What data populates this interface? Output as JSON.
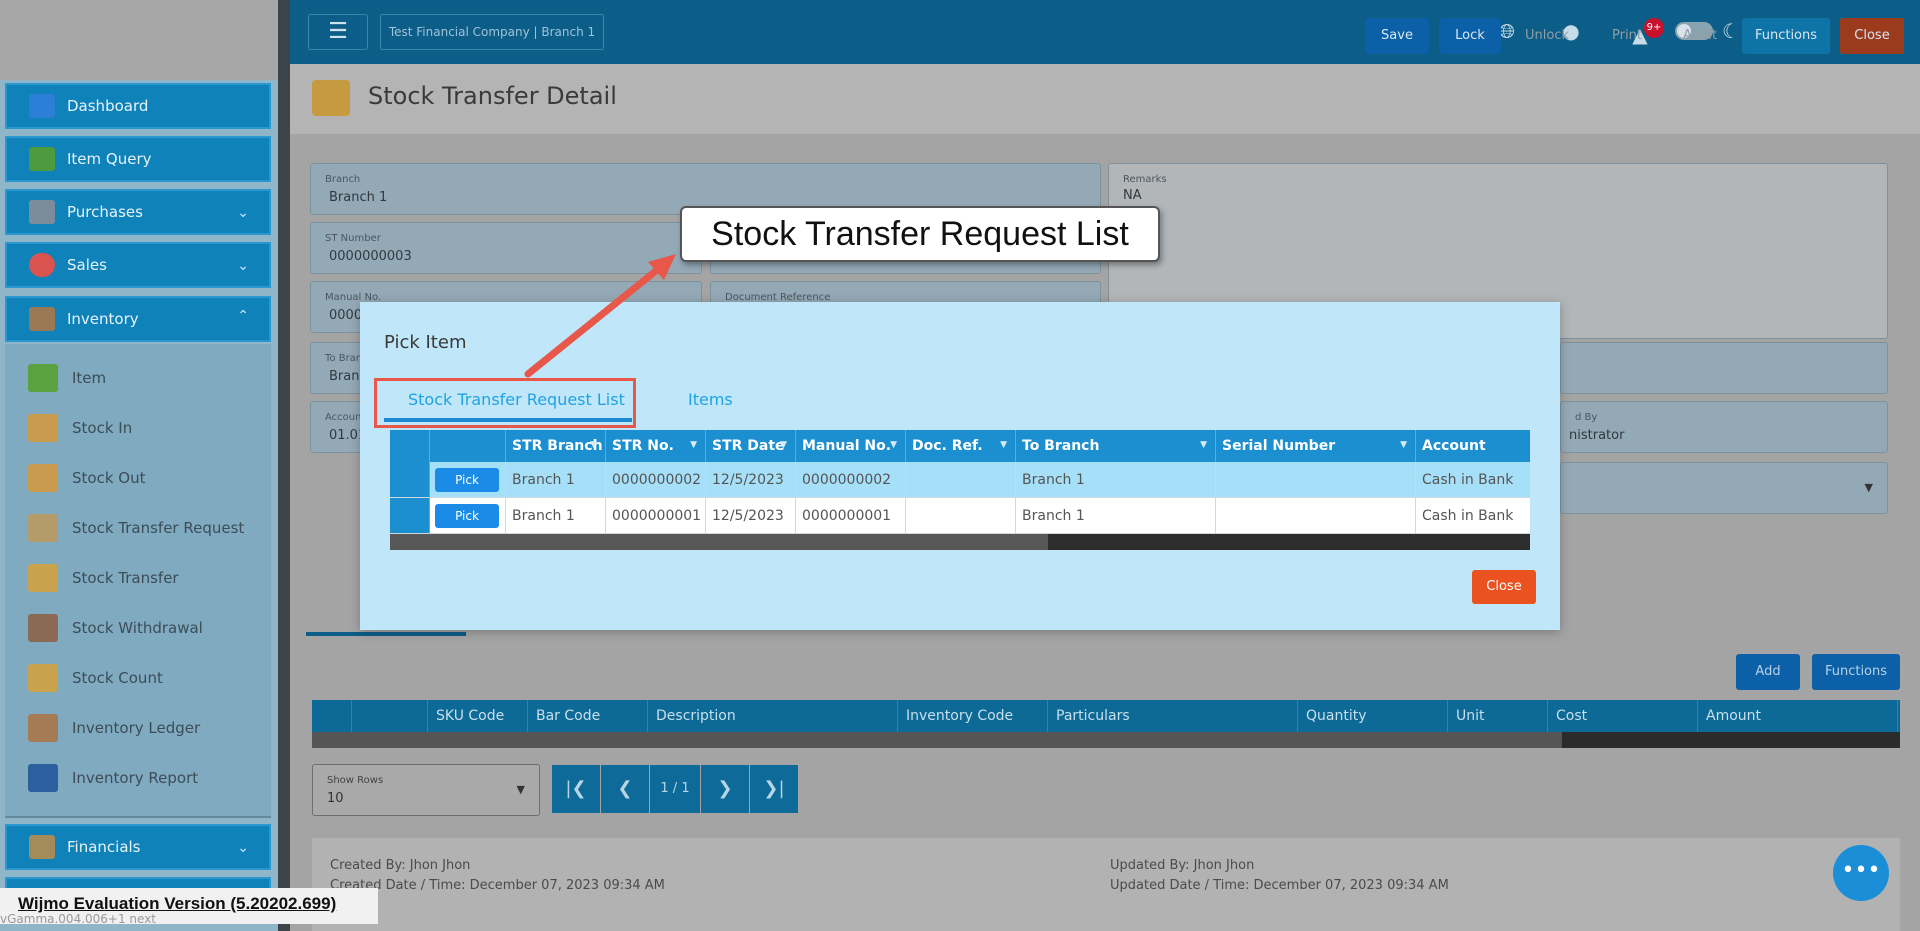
{
  "sidebar": {
    "items": [
      {
        "label": "Dashboard",
        "icon": "dashboard-icon",
        "color": "#2b7fd6"
      },
      {
        "label": "Item Query",
        "icon": "basket-icon",
        "color": "#4e9a3e"
      },
      {
        "label": "Purchases",
        "icon": "purchases-icon",
        "color": "#7c8c9a"
      },
      {
        "label": "Sales",
        "icon": "sales-icon",
        "color": "#d9534f"
      },
      {
        "label": "Inventory",
        "icon": "inventory-icon",
        "color": "#9a7a55"
      },
      {
        "label": "Financials",
        "icon": "financials-icon",
        "color": "#a58a5a"
      }
    ],
    "inventory_sub": [
      {
        "label": "Item",
        "icon": "item-icon"
      },
      {
        "label": "Stock In",
        "icon": "stock-in-icon"
      },
      {
        "label": "Stock Out",
        "icon": "stock-out-icon"
      },
      {
        "label": "Stock Transfer Request",
        "icon": "stock-transfer-request-icon"
      },
      {
        "label": "Stock Transfer",
        "icon": "stock-transfer-icon"
      },
      {
        "label": "Stock Withdrawal",
        "icon": "stock-withdrawal-icon"
      },
      {
        "label": "Stock Count",
        "icon": "stock-count-icon"
      },
      {
        "label": "Inventory Ledger",
        "icon": "inventory-ledger-icon"
      },
      {
        "label": "Inventory Report",
        "icon": "inventory-report-icon"
      }
    ]
  },
  "topbar": {
    "company": "Test Financial Company | Branch 1",
    "notification_count": "9+"
  },
  "page": {
    "title": "Stock Transfer Detail",
    "buttons": {
      "save": "Save",
      "lock": "Lock",
      "unlock": "Unlock",
      "print": "Print",
      "audit": "Audit",
      "functions": "Functions",
      "close": "Close"
    }
  },
  "form": {
    "branch": {
      "label": "Branch",
      "value": "Branch 1"
    },
    "st_number": {
      "label": "ST Number",
      "value": "0000000003"
    },
    "manual_no": {
      "label": "Manual No.",
      "value": "0000"
    },
    "document_reference": {
      "label": "Document Reference",
      "value": ""
    },
    "to_branch": {
      "label": "To Branch",
      "value": "Branc"
    },
    "account": {
      "label": "Accoun",
      "value": "01.01"
    },
    "remarks": {
      "label": "Remarks",
      "value": "NA"
    },
    "approved_by": {
      "label": "d By",
      "value": "nistrator"
    }
  },
  "items_section": {
    "add": "Add",
    "functions": "Functions",
    "columns": [
      "SKU Code",
      "Bar Code",
      "Description",
      "Inventory Code",
      "Particulars",
      "Quantity",
      "Unit",
      "Cost",
      "Amount"
    ]
  },
  "pager": {
    "show_rows_label": "Show Rows",
    "show_rows_value": "10",
    "page": "1 / 1"
  },
  "footer": {
    "created_by": "Created By: Jhon Jhon",
    "created_date": "Created Date / Time: December 07, 2023 09:34 AM",
    "updated_by": "Updated By: Jhon Jhon",
    "updated_date": "Updated Date / Time: December 07, 2023 09:34 AM"
  },
  "modal": {
    "title": "Pick Item",
    "tabs": [
      "Stock Transfer Request List",
      "Items"
    ],
    "columns": [
      "STR Branch",
      "STR No.",
      "STR Date",
      "Manual No.",
      "Doc. Ref.",
      "To Branch",
      "Serial Number",
      "Account"
    ],
    "pick_label": "Pick",
    "rows": [
      {
        "str_branch": "Branch 1",
        "str_no": "0000000002",
        "str_date": "12/5/2023",
        "manual_no": "0000000002",
        "doc_ref": "",
        "to_branch": "Branch 1",
        "serial_number": "",
        "account": "Cash in Bank"
      },
      {
        "str_branch": "Branch 1",
        "str_no": "0000000001",
        "str_date": "12/5/2023",
        "manual_no": "0000000001",
        "doc_ref": "",
        "to_branch": "Branch 1",
        "serial_number": "",
        "account": "Cash in Bank"
      }
    ],
    "close": "Close"
  },
  "callout": {
    "text": "Stock Transfer Request List"
  },
  "watermark": {
    "text": "Wijmo Evaluation Version (5.20202.699)",
    "sub": "vGamma.004.006+1 next"
  },
  "colors": {
    "accent": "#1c8fd0",
    "close": "#ea531f",
    "highlight": "#e8584a"
  }
}
